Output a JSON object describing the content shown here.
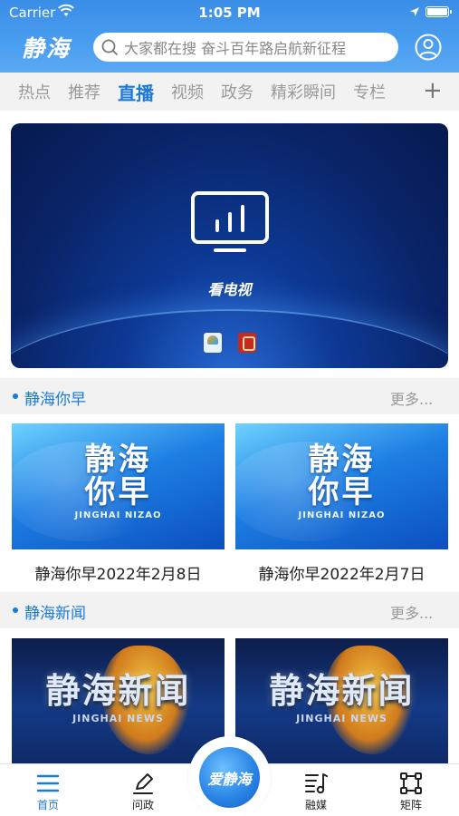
{
  "status_bar": {
    "carrier": "Carrier",
    "time": "1:05 PM"
  },
  "header": {
    "logo": "静海",
    "search_placeholder": "大家都在搜 奋斗百年路启航新征程"
  },
  "tabs": {
    "items": [
      {
        "label": "热点"
      },
      {
        "label": "推荐"
      },
      {
        "label": "直播",
        "active": true
      },
      {
        "label": "视频"
      },
      {
        "label": "政务"
      },
      {
        "label": "精彩瞬间"
      },
      {
        "label": "专栏"
      }
    ],
    "add_label": "+"
  },
  "live_banner": {
    "label": "看电视"
  },
  "sections": [
    {
      "title": "静海你早",
      "more": "更多...",
      "thumb_title": "静海\n你早",
      "thumb_sub": "JINGHAI NIZAO",
      "cards": [
        {
          "caption": "静海你早2022年2月8日"
        },
        {
          "caption": "静海你早2022年2月7日"
        }
      ]
    },
    {
      "title": "静海新闻",
      "more": "更多...",
      "thumb_title": "静海新闻",
      "thumb_sub": "JINGHAI NEWS",
      "cards": [
        {},
        {}
      ]
    }
  ],
  "bottom_nav": {
    "items": [
      {
        "label": "首页",
        "icon": "home-menu-icon",
        "active": true
      },
      {
        "label": "问政",
        "icon": "pen-icon"
      },
      {
        "label": "融媒",
        "icon": "music-list-icon"
      },
      {
        "label": "矩阵",
        "icon": "matrix-icon"
      }
    ],
    "center_label": "爱静海"
  },
  "colors": {
    "accent": "#1a7ad9",
    "header": "#4a9ef0"
  }
}
